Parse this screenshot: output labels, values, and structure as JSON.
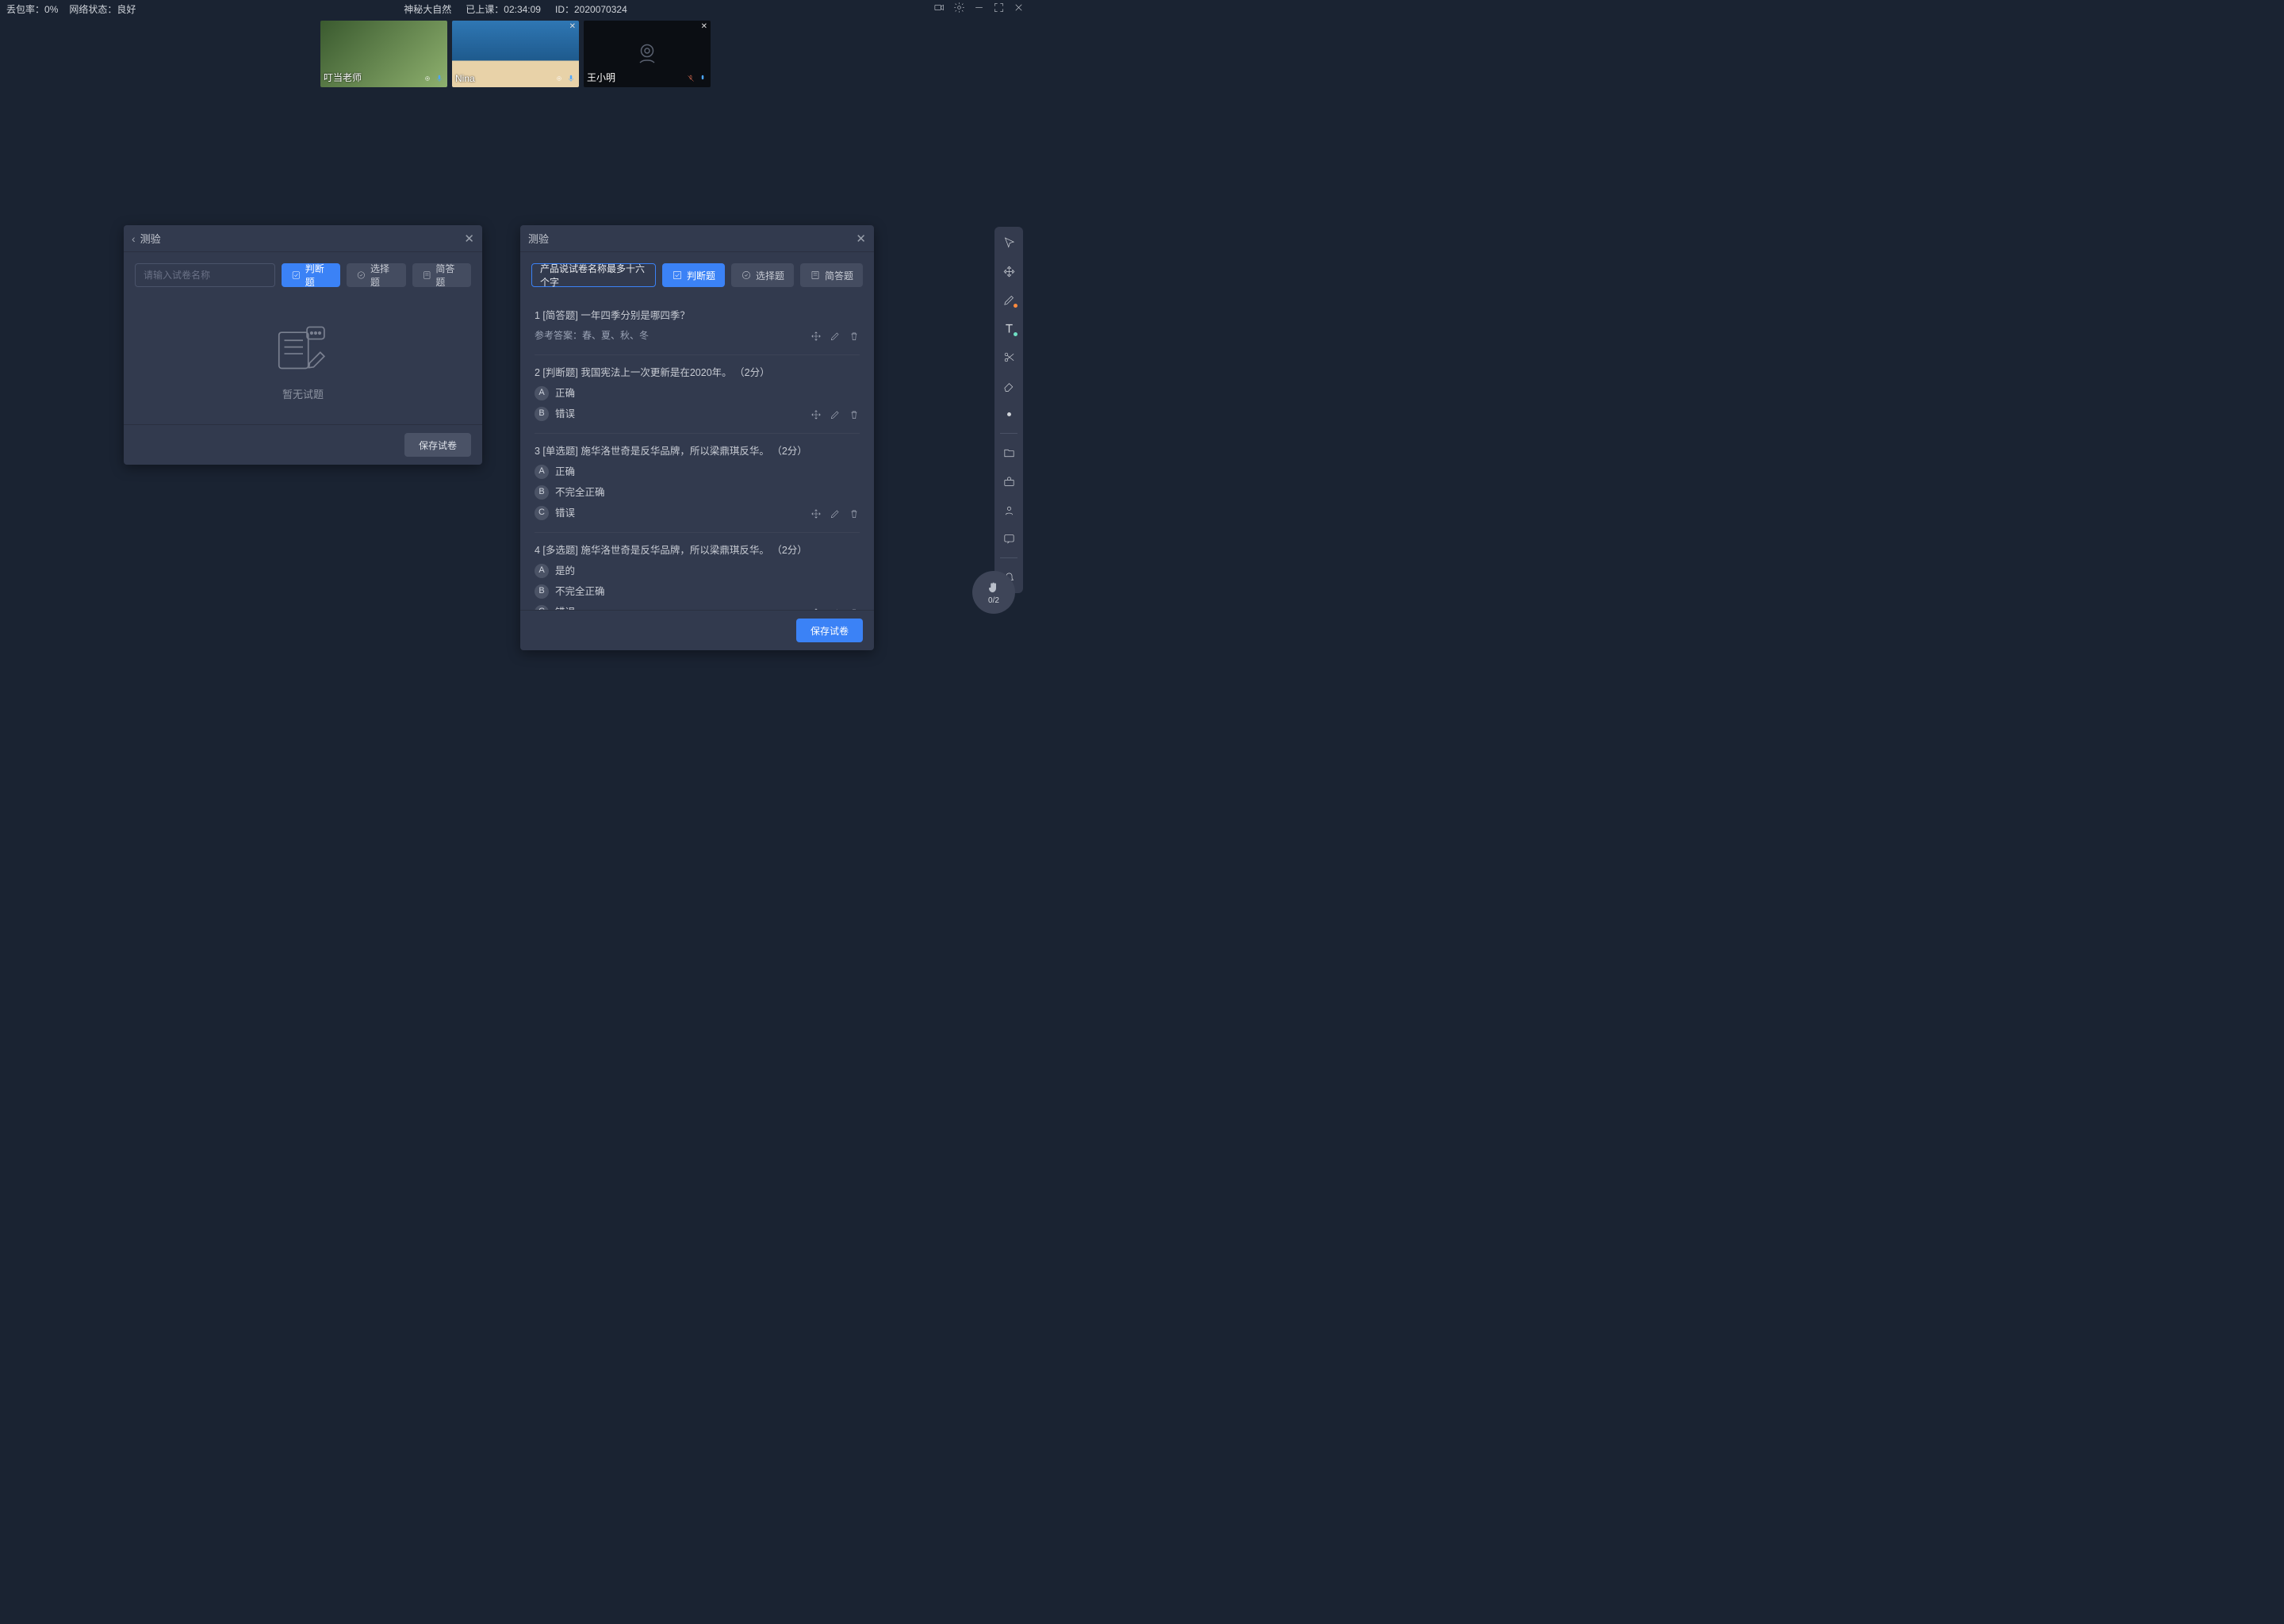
{
  "status": {
    "packet_loss_label": "丢包率：",
    "packet_loss_value": "0%",
    "network_label": "网络状态：",
    "network_value": "良好",
    "course_title": "神秘大自然",
    "elapsed_label": "已上课：",
    "elapsed_value": "02:34:09",
    "id_label": "ID：",
    "id_value": "2020070324"
  },
  "videos": [
    {
      "name": "叮当老师",
      "cam_off": false,
      "closable": false
    },
    {
      "name": "Nina",
      "cam_off": false,
      "closable": true
    },
    {
      "name": "王小明",
      "cam_off": true,
      "closable": true
    }
  ],
  "panel_left": {
    "title": "测验",
    "name_placeholder": "请输入试卷名称",
    "btn_judge": "判断题",
    "btn_choice": "选择题",
    "btn_short": "简答题",
    "empty_text": "暂无试题",
    "save": "保存试卷"
  },
  "panel_right": {
    "title": "测验",
    "name_value": "产品说试卷名称最多十六个字",
    "btn_judge": "判断题",
    "btn_choice": "选择题",
    "btn_short": "简答题",
    "save": "保存试卷",
    "questions": [
      {
        "no": "1",
        "tag": "[简答题]",
        "text": "一年四季分别是哪四季？",
        "ref_label": "参考答案：",
        "ref_value": "春、夏、秋、冬",
        "options": []
      },
      {
        "no": "2",
        "tag": "[判断题]",
        "text": "我国宪法上一次更新是在2020年。 （2分）",
        "options": [
          {
            "letter": "A",
            "label": "正确"
          },
          {
            "letter": "B",
            "label": "错误"
          }
        ]
      },
      {
        "no": "3",
        "tag": "[单选题]",
        "text": "施华洛世奇是反华品牌，所以梁鼎琪反华。 （2分）",
        "options": [
          {
            "letter": "A",
            "label": "正确"
          },
          {
            "letter": "B",
            "label": "不完全正确"
          },
          {
            "letter": "C",
            "label": "错误"
          }
        ]
      },
      {
        "no": "4",
        "tag": "[多选题]",
        "text": "施华洛世奇是反华品牌，所以梁鼎琪反华。 （2分）",
        "options": [
          {
            "letter": "A",
            "label": "是的"
          },
          {
            "letter": "B",
            "label": "不完全正确"
          },
          {
            "letter": "C",
            "label": "错误"
          }
        ]
      }
    ]
  },
  "hand": {
    "count": "0/2"
  },
  "colors": {
    "accent": "#3b82f6"
  }
}
